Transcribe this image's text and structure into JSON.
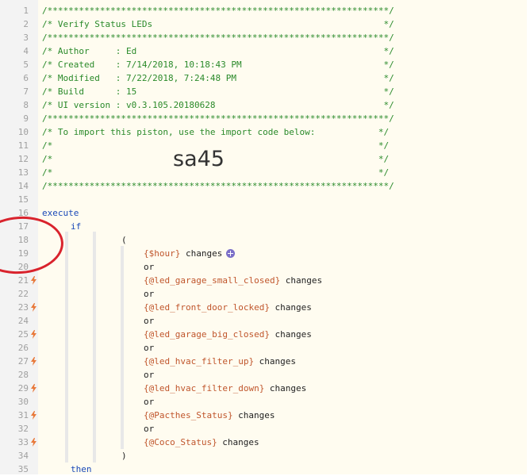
{
  "lines": [
    {
      "n": "1",
      "text": "/*****************************************************************/",
      "cls": "cm",
      "indent": 0,
      "bolt": false
    },
    {
      "n": "2",
      "text": "/* Verify Status LEDs                                            */",
      "cls": "cm",
      "indent": 0,
      "bolt": false
    },
    {
      "n": "3",
      "text": "/*****************************************************************/",
      "cls": "cm",
      "indent": 0,
      "bolt": false
    },
    {
      "n": "4",
      "text": "/* Author     : Ed                                               */",
      "cls": "cm",
      "indent": 0,
      "bolt": false
    },
    {
      "n": "5",
      "text": "/* Created    : 7/14/2018, 10:18:43 PM                           */",
      "cls": "cm",
      "indent": 0,
      "bolt": false
    },
    {
      "n": "6",
      "text": "/* Modified   : 7/22/2018, 7:24:48 PM                            */",
      "cls": "cm",
      "indent": 0,
      "bolt": false
    },
    {
      "n": "7",
      "text": "/* Build      : 15                                               */",
      "cls": "cm",
      "indent": 0,
      "bolt": false
    },
    {
      "n": "8",
      "text": "/* UI version : v0.3.105.20180628                                */",
      "cls": "cm",
      "indent": 0,
      "bolt": false
    },
    {
      "n": "9",
      "text": "/*****************************************************************/",
      "cls": "cm",
      "indent": 0,
      "bolt": false
    },
    {
      "n": "10",
      "text": "/* To import this piston, use the import code below:            */",
      "cls": "cm",
      "indent": 0,
      "bolt": false
    },
    {
      "n": "11",
      "text": "/*                                                              */",
      "cls": "cm",
      "indent": 0,
      "bolt": false
    },
    {
      "n": "12",
      "text": "/*                                                              */",
      "cls": "cm",
      "indent": 0,
      "bolt": false
    },
    {
      "n": "13",
      "text": "/*                                                              */",
      "cls": "cm",
      "indent": 0,
      "bolt": false
    },
    {
      "n": "14",
      "text": "/*****************************************************************/",
      "cls": "cm",
      "indent": 0,
      "bolt": false
    },
    {
      "n": "15",
      "text": "",
      "cls": "dflt",
      "indent": 0,
      "bolt": false
    },
    {
      "n": "16",
      "text": "execute",
      "cls": "kw",
      "indent": 0,
      "bolt": false
    },
    {
      "n": "17",
      "text": "if",
      "cls": "kw",
      "indent": 1,
      "bolt": false
    },
    {
      "n": "18",
      "text": "(",
      "cls": "dflt",
      "indent": 3,
      "bolt": false
    },
    {
      "n": "19",
      "var": "{$hour}",
      "text": " changes",
      "cls": "dflt",
      "indent": 4,
      "bolt": false,
      "plus": true
    },
    {
      "n": "20",
      "text": "or",
      "cls": "dflt",
      "indent": 4,
      "bolt": false
    },
    {
      "n": "21",
      "var": "{@led_garage_small_closed}",
      "text": " changes",
      "cls": "dflt",
      "indent": 4,
      "bolt": true
    },
    {
      "n": "22",
      "text": "or",
      "cls": "dflt",
      "indent": 4,
      "bolt": false
    },
    {
      "n": "23",
      "var": "{@led_front_door_locked}",
      "text": " changes",
      "cls": "dflt",
      "indent": 4,
      "bolt": true
    },
    {
      "n": "24",
      "text": "or",
      "cls": "dflt",
      "indent": 4,
      "bolt": false
    },
    {
      "n": "25",
      "var": "{@led_garage_big_closed}",
      "text": " changes",
      "cls": "dflt",
      "indent": 4,
      "bolt": true
    },
    {
      "n": "26",
      "text": "or",
      "cls": "dflt",
      "indent": 4,
      "bolt": false
    },
    {
      "n": "27",
      "var": "{@led_hvac_filter_up}",
      "text": " changes",
      "cls": "dflt",
      "indent": 4,
      "bolt": true
    },
    {
      "n": "28",
      "text": "or",
      "cls": "dflt",
      "indent": 4,
      "bolt": false
    },
    {
      "n": "29",
      "var": "{@led_hvac_filter_down}",
      "text": " changes",
      "cls": "dflt",
      "indent": 4,
      "bolt": true
    },
    {
      "n": "30",
      "text": "or",
      "cls": "dflt",
      "indent": 4,
      "bolt": false
    },
    {
      "n": "31",
      "var": "{@Pacthes_Status}",
      "text": " changes",
      "cls": "dflt",
      "indent": 4,
      "bolt": true
    },
    {
      "n": "32",
      "text": "or",
      "cls": "dflt",
      "indent": 4,
      "bolt": false
    },
    {
      "n": "33",
      "var": "{@Coco_Status}",
      "text": " changes",
      "cls": "dflt",
      "indent": 4,
      "bolt": true
    },
    {
      "n": "34",
      "text": ")",
      "cls": "dflt",
      "indent": 3,
      "bolt": false
    },
    {
      "n": "35",
      "text": "then",
      "cls": "kw",
      "indent": 1,
      "bolt": false
    }
  ],
  "import_code": "sa45",
  "icons": {
    "trigger": "lightning-bolt-icon",
    "add": "plus-circle-icon"
  },
  "colors": {
    "comment": "#2a8a2a",
    "keyword": "#1a49b8",
    "variable": "#c0562c",
    "annotation": "#d9232d"
  }
}
